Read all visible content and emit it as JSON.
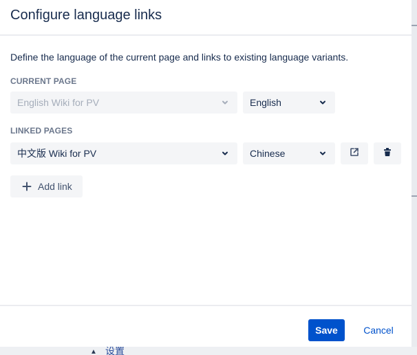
{
  "dialog": {
    "title": "Configure language links",
    "description": "Define the language of the current page and links to existing language variants."
  },
  "current_page": {
    "label": "CURRENT PAGE",
    "page_value": "English Wiki for PV",
    "language_value": "English"
  },
  "linked_pages": {
    "label": "LINKED PAGES",
    "items": [
      {
        "page_value": "中文版 Wiki for PV",
        "language_value": "Chinese",
        "open_icon": "external-link-icon",
        "delete_icon": "trash-icon"
      }
    ]
  },
  "actions": {
    "add_link_label": "Add link",
    "save_label": "Save",
    "cancel_label": "Cancel"
  },
  "background": {
    "partial_text": "设置"
  },
  "icons": {
    "chevron": "chevron-down-icon",
    "plus": "plus-icon",
    "external": "external-link-icon",
    "trash": "trash-icon"
  },
  "colors": {
    "primary": "#0052cc",
    "text": "#172b4d",
    "muted_label": "#6b778c",
    "field_bg": "#f4f5f7",
    "disabled_text": "#a5adba"
  }
}
